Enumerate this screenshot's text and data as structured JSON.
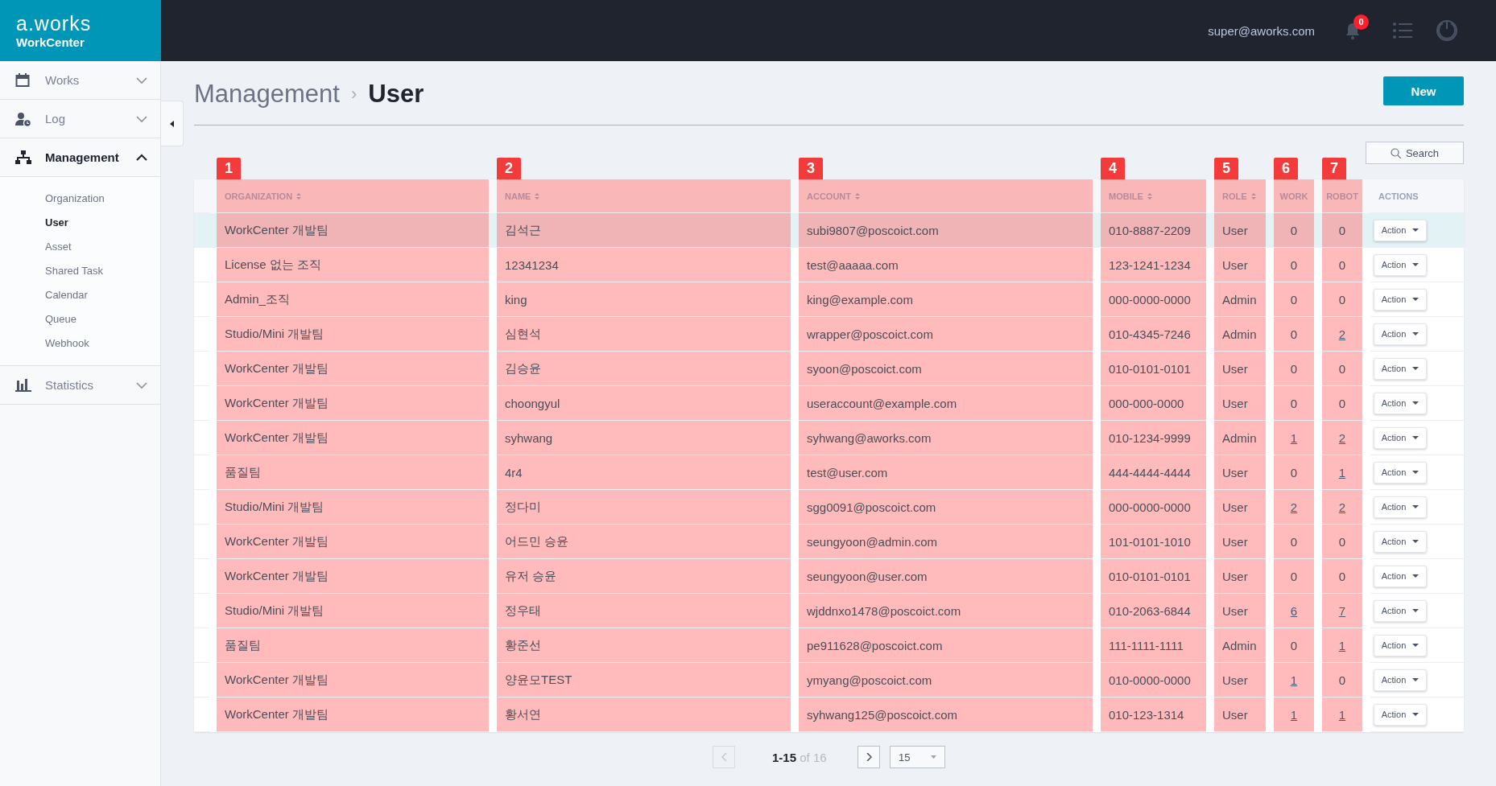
{
  "brand": {
    "logo": "a.works",
    "product": "WorkCenter"
  },
  "topbar": {
    "user": "super@aworks.com",
    "notification_count": "0"
  },
  "sidebar": {
    "items": [
      {
        "kind": "calendar",
        "label": "Works",
        "expanded": false
      },
      {
        "kind": "user-clock",
        "label": "Log",
        "expanded": false
      },
      {
        "kind": "sitemap",
        "label": "Management",
        "expanded": true,
        "children": [
          {
            "label": "Organization",
            "selected": false
          },
          {
            "label": "User",
            "selected": true
          },
          {
            "label": "Asset",
            "selected": false
          },
          {
            "label": "Shared Task",
            "selected": false
          },
          {
            "label": "Calendar",
            "selected": false
          },
          {
            "label": "Queue",
            "selected": false
          },
          {
            "label": "Webhook",
            "selected": false
          }
        ]
      },
      {
        "kind": "chart",
        "label": "Statistics",
        "expanded": false
      }
    ]
  },
  "breadcrumb": {
    "parent": "Management",
    "separator": "›",
    "current": "User"
  },
  "new_button": "New",
  "search_button": "Search",
  "table": {
    "columns": [
      {
        "label": "ORGANIZATION",
        "kind": "text",
        "sortable": true,
        "marker": "1"
      },
      {
        "label": "NAME",
        "kind": "text",
        "sortable": true,
        "marker": "2"
      },
      {
        "label": "ACCOUNT",
        "kind": "text",
        "sortable": true,
        "marker": "3"
      },
      {
        "label": "MOBILE",
        "kind": "text",
        "sortable": true,
        "marker": "4"
      },
      {
        "label": "ROLE",
        "kind": "text",
        "sortable": true,
        "marker": "5"
      },
      {
        "label": "WORK",
        "kind": "count",
        "sortable": false,
        "marker": "6"
      },
      {
        "label": "ROBOT",
        "kind": "count",
        "sortable": false,
        "marker": "7"
      },
      {
        "label": "ACTIONS",
        "kind": "actions",
        "sortable": false
      }
    ],
    "rows": [
      {
        "selected": true,
        "organization": "WorkCenter 개발팀",
        "name": "김석근",
        "account": "subi9807@poscoict.com",
        "mobile": "010-8887-2209",
        "role": "User",
        "work": {
          "text": "0",
          "link": false
        },
        "robot": {
          "text": "0",
          "link": false
        },
        "action": "Action"
      },
      {
        "selected": false,
        "organization": "License 없는 조직",
        "name": "12341234",
        "account": "test@aaaaa.com",
        "mobile": "123-1241-1234",
        "role": "User",
        "work": {
          "text": "0",
          "link": false
        },
        "robot": {
          "text": "0",
          "link": false
        },
        "action": "Action"
      },
      {
        "selected": false,
        "organization": "Admin_조직",
        "name": "king",
        "account": "king@example.com",
        "mobile": "000-0000-0000",
        "role": "Admin",
        "work": {
          "text": "0",
          "link": false
        },
        "robot": {
          "text": "0",
          "link": false
        },
        "action": "Action"
      },
      {
        "selected": false,
        "organization": "Studio/Mini 개발팀",
        "name": "심현석",
        "account": "wrapper@poscoict.com",
        "mobile": "010-4345-7246",
        "role": "Admin",
        "work": {
          "text": "0",
          "link": false
        },
        "robot": {
          "text": "2",
          "link": true
        },
        "action": "Action"
      },
      {
        "selected": false,
        "organization": "WorkCenter 개발팀",
        "name": "김승윤",
        "account": "syoon@poscoict.com",
        "mobile": "010-0101-0101",
        "role": "User",
        "work": {
          "text": "0",
          "link": false
        },
        "robot": {
          "text": "0",
          "link": false
        },
        "action": "Action"
      },
      {
        "selected": false,
        "organization": "WorkCenter 개발팀",
        "name": "choongyul",
        "account": "useraccount@example.com",
        "mobile": "000-000-0000",
        "role": "User",
        "work": {
          "text": "0",
          "link": false
        },
        "robot": {
          "text": "0",
          "link": false
        },
        "action": "Action"
      },
      {
        "selected": false,
        "organization": "WorkCenter 개발팀",
        "name": "syhwang",
        "account": "syhwang@aworks.com",
        "mobile": "010-1234-9999",
        "role": "Admin",
        "work": {
          "text": "1",
          "link": true
        },
        "robot": {
          "text": "2",
          "link": true
        },
        "action": "Action"
      },
      {
        "selected": false,
        "organization": "품질팀",
        "name": "4r4",
        "account": "test@user.com",
        "mobile": "444-4444-4444",
        "role": "User",
        "work": {
          "text": "0",
          "link": false
        },
        "robot": {
          "text": "1",
          "link": true
        },
        "action": "Action"
      },
      {
        "selected": false,
        "organization": "Studio/Mini 개발팀",
        "name": "정다미",
        "account": "sgg0091@poscoict.com",
        "mobile": "000-0000-0000",
        "role": "User",
        "work": {
          "text": "2",
          "link": true
        },
        "robot": {
          "text": "2",
          "link": true
        },
        "action": "Action"
      },
      {
        "selected": false,
        "organization": "WorkCenter 개발팀",
        "name": "어드민 승윤",
        "account": "seungyoon@admin.com",
        "mobile": "101-0101-1010",
        "role": "User",
        "work": {
          "text": "0",
          "link": false
        },
        "robot": {
          "text": "0",
          "link": false
        },
        "action": "Action"
      },
      {
        "selected": false,
        "organization": "WorkCenter 개발팀",
        "name": "유저 승윤",
        "account": "seungyoon@user.com",
        "mobile": "010-0101-0101",
        "role": "User",
        "work": {
          "text": "0",
          "link": false
        },
        "robot": {
          "text": "0",
          "link": false
        },
        "action": "Action"
      },
      {
        "selected": false,
        "organization": "Studio/Mini 개발팀",
        "name": "정우태",
        "account": "wjddnxo1478@poscoict.com",
        "mobile": "010-2063-6844",
        "role": "User",
        "work": {
          "text": "6",
          "link": true
        },
        "robot": {
          "text": "7",
          "link": true
        },
        "action": "Action"
      },
      {
        "selected": false,
        "organization": "품질팀",
        "name": "황준선",
        "account": "pe911628@poscoict.com",
        "mobile": "111-1111-1111",
        "role": "Admin",
        "work": {
          "text": "0",
          "link": false
        },
        "robot": {
          "text": "1",
          "link": true
        },
        "action": "Action"
      },
      {
        "selected": false,
        "organization": "WorkCenter 개발팀",
        "name": "양윤모TEST",
        "account": "ymyang@poscoict.com",
        "mobile": "010-0000-0000",
        "role": "User",
        "work": {
          "text": "1",
          "link": true
        },
        "robot": {
          "text": "0",
          "link": false
        },
        "action": "Action"
      },
      {
        "selected": false,
        "organization": "WorkCenter 개발팀",
        "name": "황서연",
        "account": "syhwang125@poscoict.com",
        "mobile": "010-123-1314",
        "role": "User",
        "work": {
          "text": "1",
          "link": true
        },
        "robot": {
          "text": "1",
          "link": true
        },
        "action": "Action"
      }
    ]
  },
  "pagination": {
    "range": "**1-15** of 16",
    "prev_disabled": true,
    "page_size": "15"
  }
}
